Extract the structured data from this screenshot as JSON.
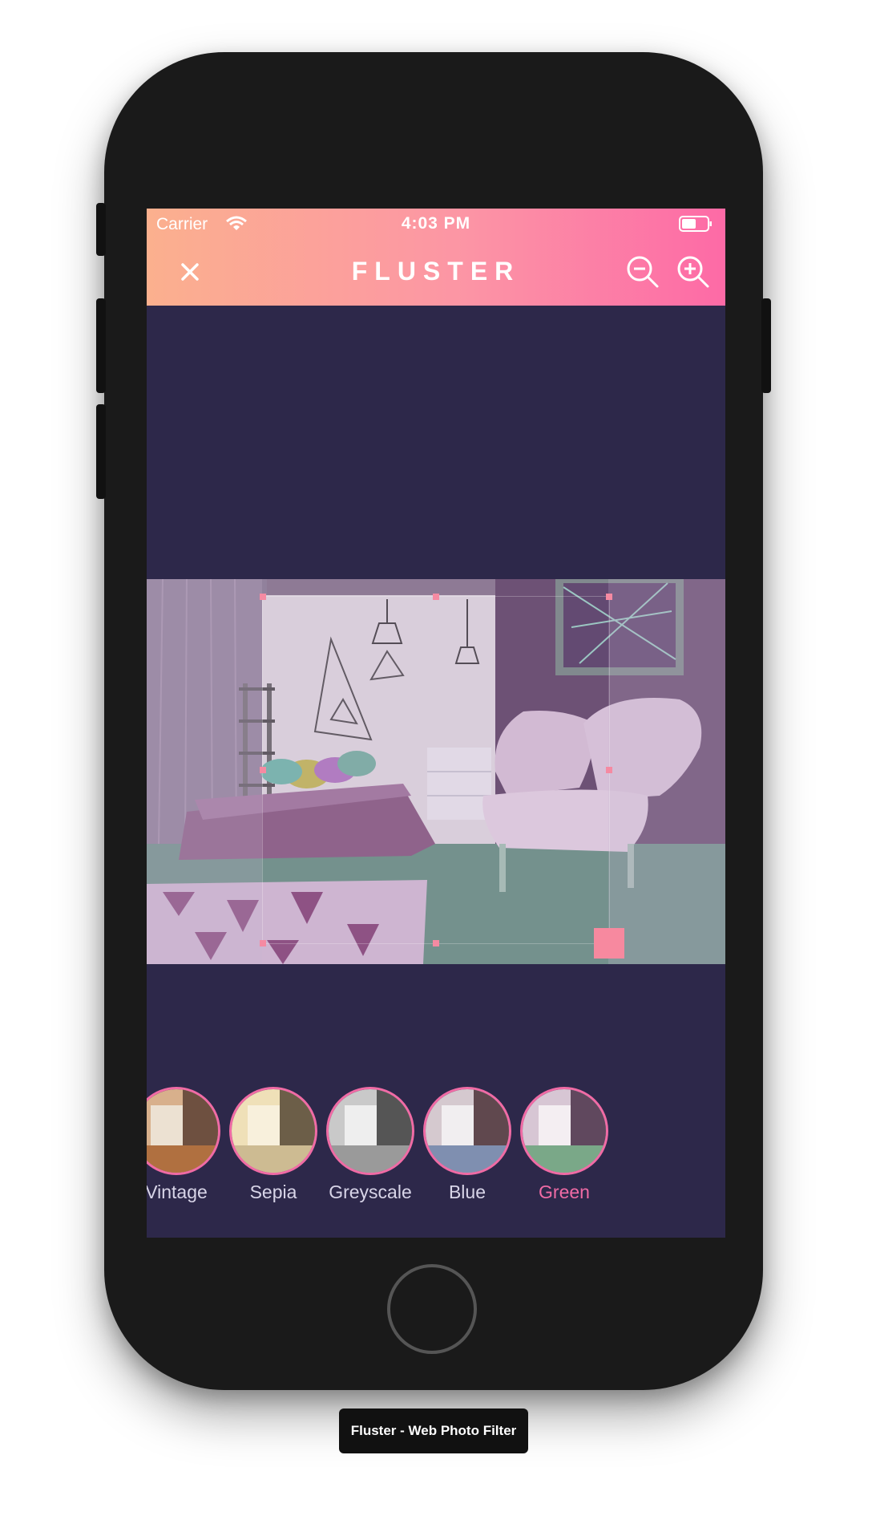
{
  "status_bar": {
    "carrier": "Carrier",
    "time": "4:03 PM"
  },
  "header": {
    "title": "FLUSTER",
    "close_icon": "close-icon",
    "zoom_out_icon": "zoom-out-icon",
    "zoom_in_icon": "zoom-in-icon"
  },
  "colors": {
    "accent": "#f06ba5",
    "background": "#2d284a",
    "gradient_start": "#fbb08e",
    "gradient_end": "#fd6aa6"
  },
  "filters": [
    {
      "label": "Vintage",
      "active": false
    },
    {
      "label": "Sepia",
      "active": false
    },
    {
      "label": "Greyscale",
      "active": false
    },
    {
      "label": "Blue",
      "active": false
    },
    {
      "label": "Green",
      "active": true
    }
  ],
  "caption": "Fluster - Web Photo Filter"
}
